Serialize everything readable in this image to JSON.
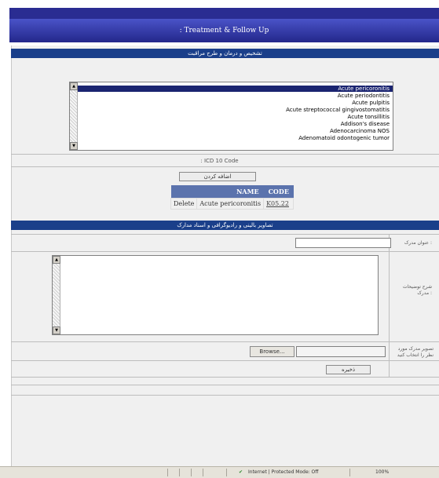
{
  "page": {
    "title": ": Treatment & Follow Up"
  },
  "diagnosis_section": {
    "title": "تشخیص و درمان و طرح مراقبت"
  },
  "icd_list": {
    "options": [
      "Acute pericoronitis",
      "Acute periodontitis",
      "Acute pulpitis",
      "Acute streptococcal gingivostomatitis",
      "Acute tonsillitis",
      "Addison's disease",
      "Adenocarcinoma NOS",
      "Adenomatoid odontogenic tumor"
    ],
    "selected_index": 0
  },
  "icd_code_label": ": ICD 10 Code",
  "add_button": "اضافه کردن",
  "icd_table": {
    "headers": {
      "name": "NAME",
      "code": "CODE"
    },
    "row": {
      "delete": "Delete",
      "name": "Acute pericoronitis",
      "code": "K05.22"
    }
  },
  "followup_section": {
    "title": "تصاویر بالینی و رادیوگرافی و اسناد مدارک"
  },
  "doc_title_label": "عنوان مدرک :",
  "description_label": "شرح توضیحات مدرک :",
  "image_label": "تصویر مدرک مورد نظر را انتخاب کنید",
  "browse_button": "Browse...",
  "submit_button": "ذخیره",
  "statusbar": {
    "mode": "Internet | Protected Mode: Off",
    "zoom": "100%"
  }
}
